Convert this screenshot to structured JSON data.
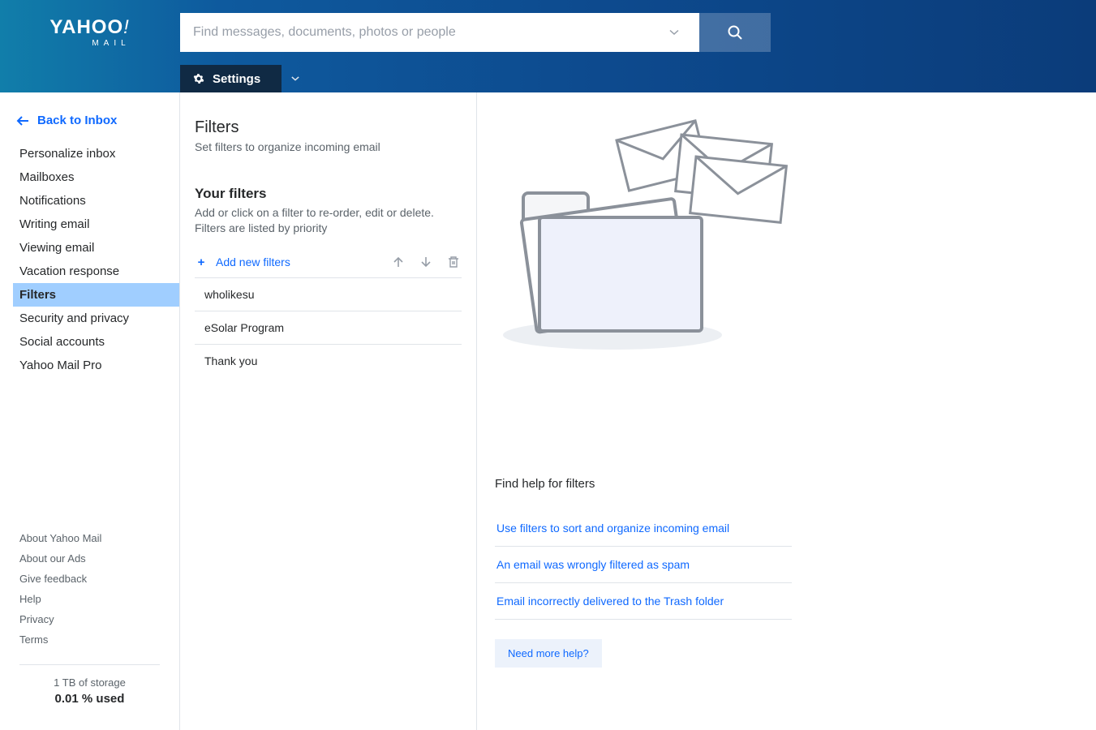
{
  "header": {
    "logo_main": "YAHOO",
    "logo_excl": "!",
    "logo_sub": "MAIL",
    "search_placeholder": "Find messages, documents, photos or people"
  },
  "tabbar": {
    "settings_label": "Settings"
  },
  "sidebar": {
    "back_label": "Back to Inbox",
    "items": [
      {
        "label": "Personalize inbox",
        "selected": false
      },
      {
        "label": "Mailboxes",
        "selected": false
      },
      {
        "label": "Notifications",
        "selected": false
      },
      {
        "label": "Writing email",
        "selected": false
      },
      {
        "label": "Viewing email",
        "selected": false
      },
      {
        "label": "Vacation response",
        "selected": false
      },
      {
        "label": "Filters",
        "selected": true
      },
      {
        "label": "Security and privacy",
        "selected": false
      },
      {
        "label": "Social accounts",
        "selected": false
      },
      {
        "label": "Yahoo Mail Pro",
        "selected": false
      }
    ],
    "footer_links": [
      {
        "label": "About Yahoo Mail"
      },
      {
        "label": "About our Ads"
      },
      {
        "label": "Give feedback"
      },
      {
        "label": "Help"
      },
      {
        "label": "Privacy"
      },
      {
        "label": "Terms"
      }
    ],
    "storage_line1": "1 TB of storage",
    "storage_line2": "0.01 % used"
  },
  "mid": {
    "title": "Filters",
    "subtitle": "Set filters to organize incoming email",
    "your_filters_title": "Your filters",
    "your_filters_desc": "Add or click on a filter to re-order, edit or delete. Filters are listed by priority",
    "add_label": "Add new filters",
    "filters": [
      {
        "name": "wholikesu"
      },
      {
        "name": "eSolar Program"
      },
      {
        "name": "Thank you"
      }
    ]
  },
  "right": {
    "help_heading": "Find help for filters",
    "help_links": [
      {
        "label": "Use filters to sort and organize incoming email"
      },
      {
        "label": "An email was wrongly filtered as spam"
      },
      {
        "label": "Email incorrectly delivered to the Trash folder"
      }
    ],
    "need_help_label": "Need more help?"
  }
}
